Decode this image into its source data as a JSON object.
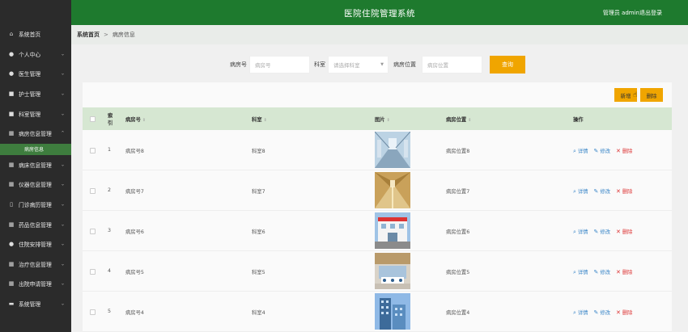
{
  "header": {
    "title": "医院住院管理系统",
    "user": "管理员 admin",
    "logout": "退出登录"
  },
  "sidebar": {
    "items": [
      {
        "label": "系统首页",
        "icon": "home-icon",
        "glyph": "⌂",
        "caret": ""
      },
      {
        "label": "个人中心",
        "icon": "user-icon",
        "glyph": "●",
        "caret": "⌄"
      },
      {
        "label": "医生管理",
        "icon": "doctor-icon",
        "glyph": "●",
        "caret": "⌄"
      },
      {
        "label": "护士管理",
        "icon": "nurse-icon",
        "glyph": "■",
        "caret": "⌄"
      },
      {
        "label": "科室管理",
        "icon": "department-icon",
        "glyph": "■",
        "caret": "⌄"
      },
      {
        "label": "病房信息管理",
        "icon": "ward-icon",
        "glyph": "▦",
        "caret": "⌃"
      },
      {
        "label": "病床信息管理",
        "icon": "bed-icon",
        "glyph": "▦",
        "caret": "⌄"
      },
      {
        "label": "仪器信息管理",
        "icon": "instrument-icon",
        "glyph": "▦",
        "caret": "⌄"
      },
      {
        "label": "门诊病历管理",
        "icon": "record-icon",
        "glyph": "▯",
        "caret": "⌄"
      },
      {
        "label": "药品信息管理",
        "icon": "medicine-icon",
        "glyph": "▦",
        "caret": "⌄"
      },
      {
        "label": "住院安排管理",
        "icon": "person-icon",
        "glyph": "●",
        "caret": "⌄"
      },
      {
        "label": "治疗信息管理",
        "icon": "treatment-icon",
        "glyph": "▦",
        "caret": "⌄"
      },
      {
        "label": "出院申请管理",
        "icon": "discharge-icon",
        "glyph": "▦",
        "caret": "⌄"
      },
      {
        "label": "系统管理",
        "icon": "system-icon",
        "glyph": "▬",
        "caret": "⌄"
      }
    ],
    "sub_item": "病房信息"
  },
  "breadcrumb": {
    "home": "系统首页",
    "sep": ">",
    "current": "病房信息"
  },
  "search": {
    "ward_no_label": "病房号",
    "ward_no_placeholder": "病房号",
    "dept_label": "科室",
    "dept_placeholder": "请选择科室",
    "location_label": "病房位置",
    "location_placeholder": "病房位置",
    "query": "查询"
  },
  "toolbar": {
    "add": "新增",
    "delete": "删除"
  },
  "table": {
    "columns": {
      "index": "索引",
      "ward_no": "病房号",
      "department": "科室",
      "picture": "图片",
      "location": "病房位置",
      "ops": "操作"
    },
    "sort_icon": "⇕",
    "ops": {
      "detail": "详情",
      "edit": "修改",
      "delete": "删除"
    },
    "rows": [
      {
        "index": "1",
        "ward_no": "病房号8",
        "department": "科室8",
        "location": "病房位置8"
      },
      {
        "index": "2",
        "ward_no": "病房号7",
        "department": "科室7",
        "location": "病房位置7"
      },
      {
        "index": "3",
        "ward_no": "病房号6",
        "department": "科室6",
        "location": "病房位置6"
      },
      {
        "index": "4",
        "ward_no": "病房号5",
        "department": "科室5",
        "location": "病房位置5"
      },
      {
        "index": "5",
        "ward_no": "病房号4",
        "department": "科室4",
        "location": "病房位置4"
      }
    ]
  },
  "colors": {
    "topbar": "#1e7a2e",
    "sidebar": "#2b2b2b",
    "accent": "#f0a500",
    "table_header": "#d6e7d2",
    "link": "#3a86c8",
    "danger": "#dd3333"
  }
}
